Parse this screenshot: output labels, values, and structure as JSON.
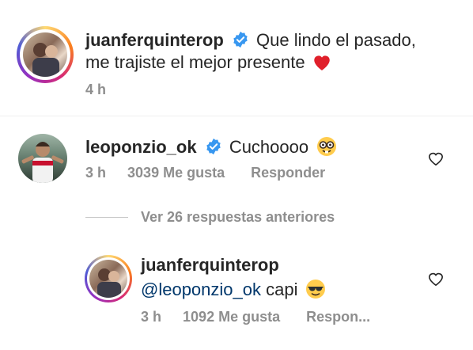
{
  "post_caption": {
    "username": "juanferquinterop",
    "text_line1": "Que lindo el pasado,",
    "text_line2": "me trajiste el mejor presente",
    "emoji": "❤️",
    "time": "4 h"
  },
  "comment": {
    "username": "leoponzio_ok",
    "text": "Cuchoooo",
    "emoji": "nerd-face",
    "time": "3 h",
    "likes": "3039 Me gusta",
    "reply_label": "Responder"
  },
  "view_replies": {
    "label": "Ver 26 respuestas anteriores"
  },
  "reply": {
    "username": "juanferquinterop",
    "mention": "@leoponzio_ok",
    "text": "capi",
    "emoji": "sunglasses-face",
    "time": "3 h",
    "likes": "1092 Me gusta",
    "reply_label": "Respon..."
  },
  "colors": {
    "text": "#262626",
    "meta": "#8e8e8e",
    "verified": "#3897f0",
    "mention": "#00376b",
    "heart": "#ed4956"
  }
}
